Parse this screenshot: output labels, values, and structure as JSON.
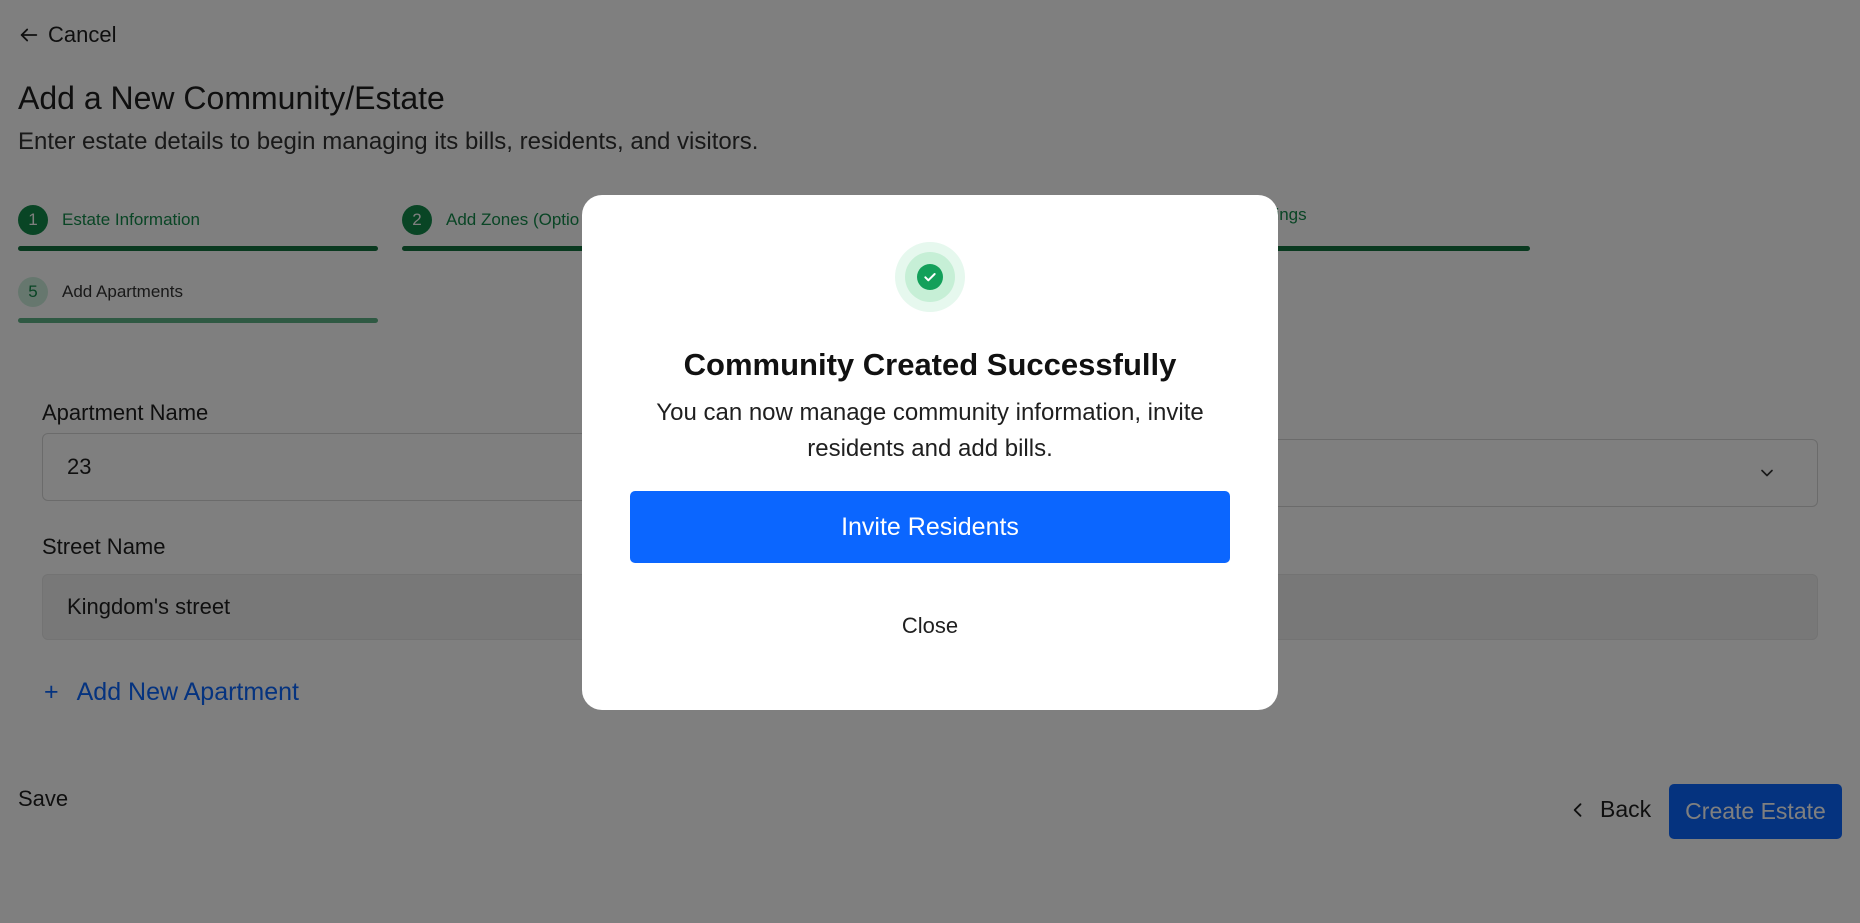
{
  "header": {
    "cancel_label": "Cancel",
    "title": "Add a New Community/Estate",
    "subtitle": "Enter estate details to begin managing its bills, residents, and visitors."
  },
  "steps": [
    {
      "number": "1",
      "label": "Estate Information",
      "state": "done"
    },
    {
      "number": "2",
      "label": "Add Zones (Optio",
      "state": "done"
    },
    {
      "number": "",
      "label": "dings",
      "state": "done"
    },
    {
      "number": "5",
      "label": "Add Apartments",
      "state": "current"
    }
  ],
  "form": {
    "apartment_name_label": "Apartment Name",
    "apartment_name_value": "23",
    "street_name_label": "Street Name",
    "street_name_value": "Kingdom's street",
    "add_apartment_label": "Add New Apartment"
  },
  "footer": {
    "save_label": "Save",
    "back_label": "Back",
    "create_label": "Create Estate"
  },
  "modal": {
    "title": "Community Created Successfully",
    "text": "You can now manage community information, invite residents and add bills.",
    "invite_label": "Invite Residents",
    "close_label": "Close"
  },
  "colors": {
    "primary": "#0b66ff",
    "success": "#13a05a",
    "step_done": "#13733f"
  }
}
